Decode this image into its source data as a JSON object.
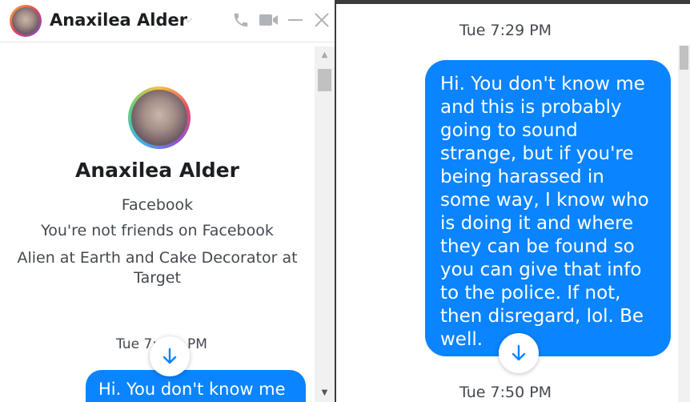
{
  "header": {
    "contact_name": "Anaxilea Alder",
    "dropdown_icon": "chevron-down-icon",
    "actions": [
      "phone-icon",
      "video-camera-icon",
      "minimize-icon",
      "close-icon"
    ]
  },
  "profile": {
    "name": "Anaxilea Alder",
    "platform": "Facebook",
    "friendship_status": "You're not friends on Facebook",
    "bio_line1": "Alien at Earth and Cake Decorator at",
    "bio_line2": "Target"
  },
  "left_chat": {
    "timestamp": "Tue 7:",
    "timestamp_tail": "PM",
    "message_preview": "Hi. You don't know me"
  },
  "right_chat": {
    "timestamp_top": "Tue 7:29 PM",
    "message_lines": [
      "Hi. You don't know me",
      "and this is probably",
      "going to sound",
      "strange, but if you're",
      "being harassed in",
      "some way, I know who",
      "is doing it and where",
      "they can be found so",
      "you can give that info",
      "to the police. If not,",
      "then disregard, lol. Be",
      "well."
    ],
    "timestamp_bottom": "Tue 7:50 PM"
  },
  "colors": {
    "bubble": "#0a84ff",
    "icon_gray": "#b0b3b8"
  }
}
